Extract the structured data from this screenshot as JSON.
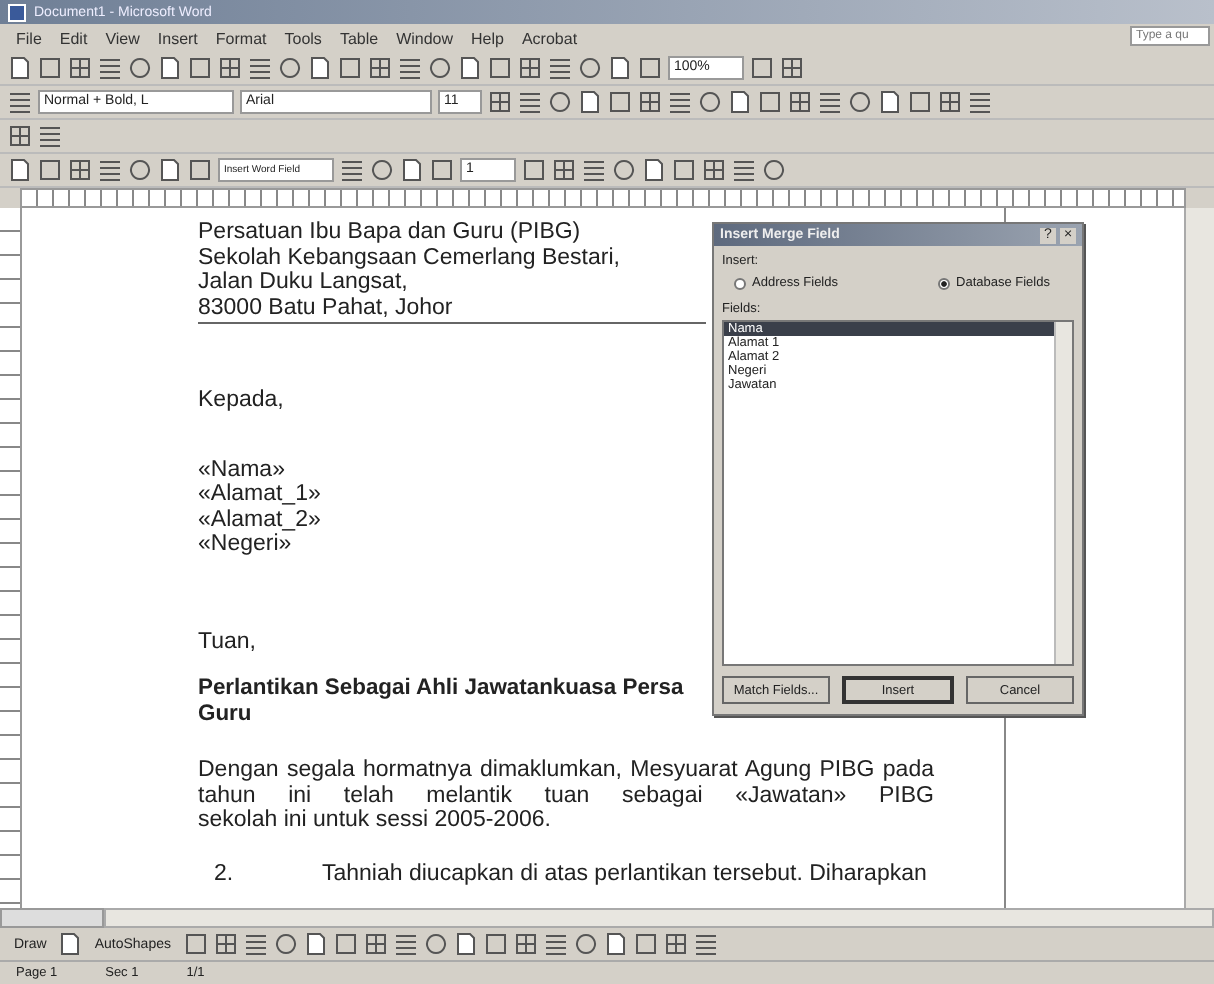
{
  "window": {
    "title": "Document1 - Microsoft Word"
  },
  "menu": [
    "File",
    "Edit",
    "View",
    "Insert",
    "Format",
    "Tools",
    "Table",
    "Window",
    "Help",
    "Acrobat"
  ],
  "help_box": {
    "placeholder": "Type a qu"
  },
  "formatting": {
    "style": "Normal + Bold, L",
    "font": "Arial",
    "size": "11",
    "zoom": "100%"
  },
  "mail_merge": {
    "word_field": "Insert Word Field",
    "record": "1"
  },
  "document": {
    "header_lines": [
      "Persatuan Ibu Bapa dan Guru (PIBG)",
      "Sekolah Kebangsaan Cemerlang Bestari,",
      "Jalan Duku Langsat,",
      "83000 Batu Pahat, Johor"
    ],
    "blocks": [
      {
        "kind": "para",
        "lines": [
          "Kepada,"
        ]
      },
      {
        "kind": "para",
        "lines": [
          "«Nama»",
          "«Alamat_1»",
          "«Alamat_2»",
          "«Negeri»"
        ]
      },
      {
        "kind": "para",
        "lines": [
          "Tuan,"
        ]
      },
      {
        "kind": "heading",
        "lines": [
          "Perlantikan Sebagai Ahli Jawatankuasa Persa",
          "Guru"
        ]
      },
      {
        "kind": "justified",
        "lines": [
          "Dengan segala hormatnya dimaklumkan, Mesyuarat Agung PIBG pada",
          "tahun ini telah melantik tuan sebagai «Jawatan» PIBG",
          "sekolah ini untuk sessi 2005-2006."
        ]
      },
      {
        "kind": "numbered",
        "number": "2.",
        "lines": [
          "Tahniah diucapkan di atas perlantikan tersebut.  Diharapkan"
        ]
      }
    ]
  },
  "dialog": {
    "title": "Insert Merge Field",
    "help": "?",
    "close": "×",
    "group_label": "Insert:",
    "options": [
      {
        "label": "Address Fields",
        "selected": false
      },
      {
        "label": "Database Fields",
        "selected": true
      }
    ],
    "fields_label": "Fields:",
    "fields": [
      {
        "label": "Nama",
        "selected": true
      },
      {
        "label": "Alamat 1",
        "selected": false
      },
      {
        "label": "Alamat 2",
        "selected": false
      },
      {
        "label": "Negeri",
        "selected": false
      },
      {
        "label": "Jawatan",
        "selected": false
      }
    ],
    "buttons": [
      "Match Fields...",
      "Insert",
      "Cancel"
    ]
  },
  "drawing_toolbar": {
    "draw": "Draw",
    "autoshapes": "AutoShapes"
  },
  "status_bar": [
    "Page 1",
    "Sec 1",
    "1/1"
  ]
}
